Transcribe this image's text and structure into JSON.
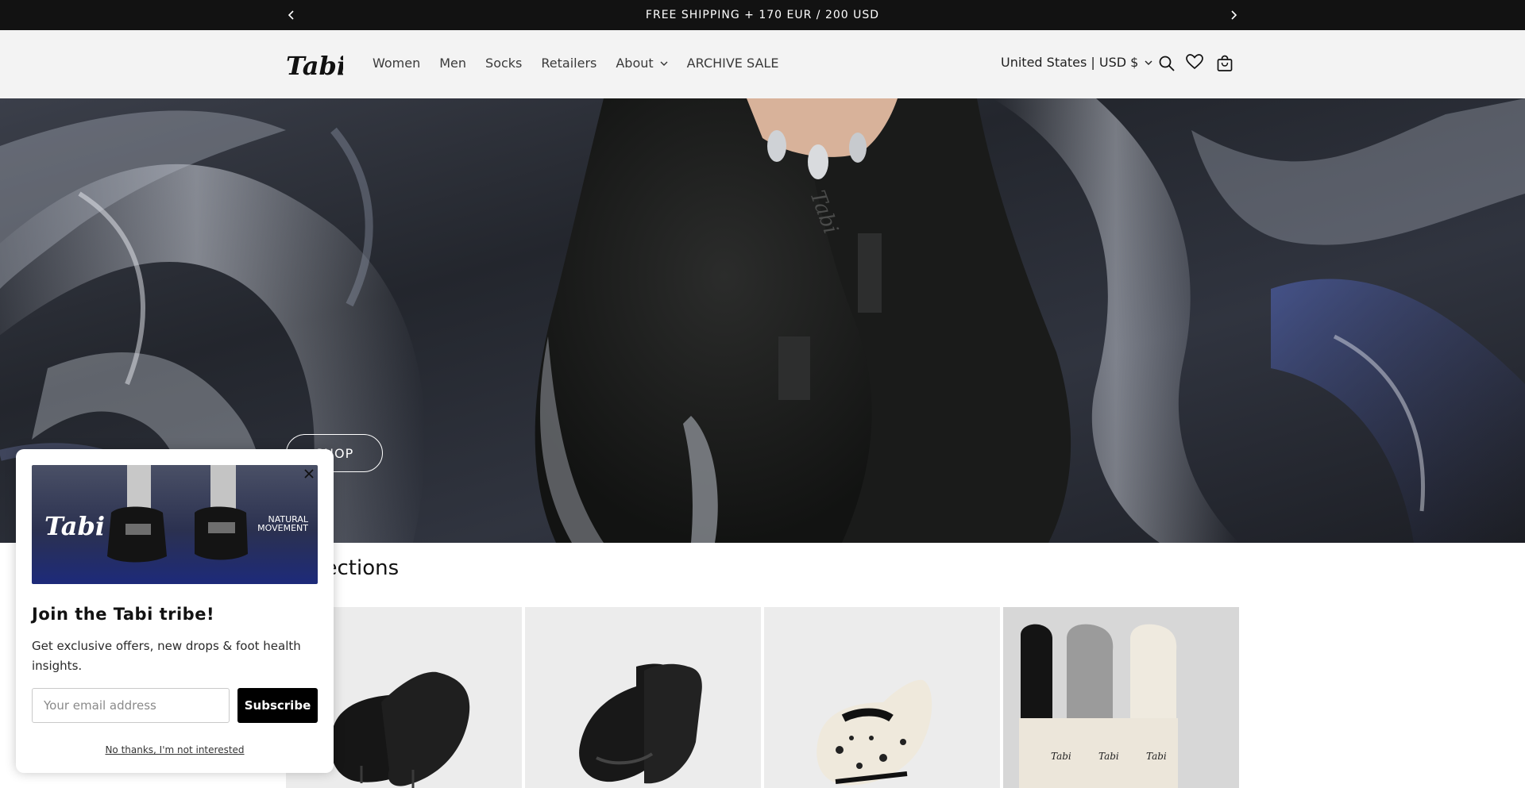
{
  "announcement": {
    "text": "FREE SHIPPING + 170 EUR / 200 USD",
    "prev_icon": "chevron-left-icon",
    "next_icon": "chevron-right-icon"
  },
  "header": {
    "logo_text": "Tabi",
    "nav": [
      {
        "label": "Women"
      },
      {
        "label": "Men"
      },
      {
        "label": "Socks"
      },
      {
        "label": "Retailers"
      },
      {
        "label": "About",
        "has_dropdown": true
      },
      {
        "label": "ARCHIVE SALE"
      }
    ],
    "country_selector": "United States | USD $",
    "icons": [
      "search-icon",
      "heart-icon",
      "cart-icon"
    ]
  },
  "hero": {
    "button_label": "SHOP"
  },
  "collections": {
    "title": "Collections",
    "cards": [
      {
        "name": "black-tabi-slip-on"
      },
      {
        "name": "black-tabi-high-top"
      },
      {
        "name": "leopard-tabi-mary-jane"
      },
      {
        "name": "tabi-socks-pack"
      }
    ]
  },
  "popup": {
    "image_logo_text": "Tabi",
    "image_caption_line1": "NATURAL",
    "image_caption_line2": "MOVEMENT",
    "title": "Join the Tabi tribe!",
    "description": "Get exclusive offers, new drops & foot health insights.",
    "email_placeholder": "Your email address",
    "subscribe_label": "Subscribe",
    "dismiss_label": "No thanks, I'm not interested"
  },
  "colors": {
    "announcement_bg": "#121212",
    "header_bg": "#f3f3f3",
    "button_bg": "#000000"
  }
}
